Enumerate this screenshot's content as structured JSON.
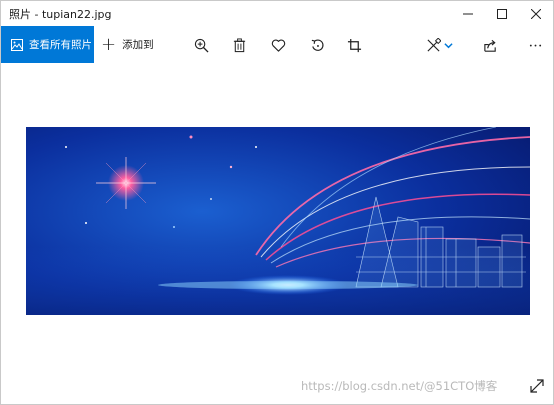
{
  "window": {
    "title": "照片 - tupian22.jpg"
  },
  "toolbar": {
    "view_all_label": "查看所有照片",
    "add_to_label": "添加到",
    "tools": [
      "zoom-in-icon",
      "delete-icon",
      "favorite-icon",
      "rotate-icon",
      "crop-icon",
      "edit-create-icon",
      "share-icon",
      "more-icon"
    ]
  },
  "colors": {
    "accent": "#0078d7"
  },
  "footer": {
    "watermark": "https://blog.csdn.net/@51CTO博客"
  }
}
